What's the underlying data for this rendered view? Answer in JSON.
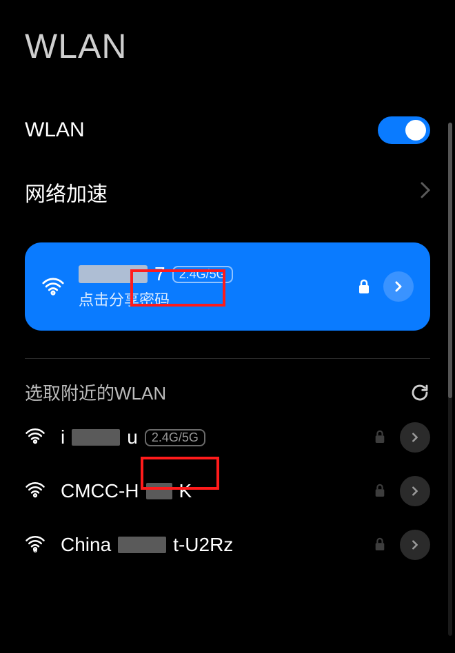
{
  "page": {
    "title": "WLAN"
  },
  "wlan_row": {
    "label": "WLAN",
    "enabled": true
  },
  "accel_row": {
    "label": "网络加速"
  },
  "connected": {
    "ssid_suffix": "7",
    "band_badge": "2.4G/5G",
    "subtitle": "点击分享密码"
  },
  "nearby": {
    "title": "选取附近的WLAN",
    "items": [
      {
        "name_prefix": "i",
        "name_suffix": "u",
        "band_badge": "2.4G/5G",
        "secured": true,
        "wifi6": false
      },
      {
        "name_prefix": "CMCC-H",
        "name_suffix": "K",
        "band_badge": null,
        "secured": true,
        "wifi6": false
      },
      {
        "name_prefix": "China",
        "name_suffix": "t-U2Rz",
        "band_badge": null,
        "secured": true,
        "wifi6": true
      }
    ]
  }
}
